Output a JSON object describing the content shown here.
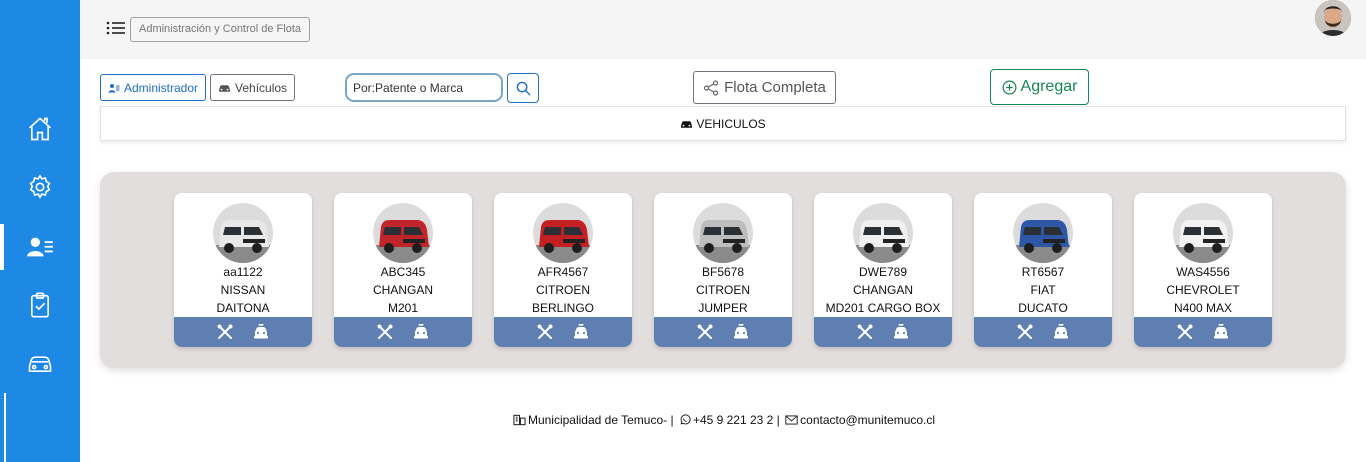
{
  "header": {
    "title": "Administración y Control de Flota"
  },
  "sidebar": {
    "items": [
      {
        "name": "home-icon"
      },
      {
        "name": "gear-icon"
      },
      {
        "name": "users-icon",
        "active": true
      },
      {
        "name": "clipboard-check-icon"
      },
      {
        "name": "car-icon"
      }
    ]
  },
  "toolbar": {
    "admin_label": "Administrador",
    "vehicles_label": "Vehículos",
    "search_placeholder": "Por:Patente o Marca",
    "fleet_label": "Flota Completa",
    "add_label": "Agregar"
  },
  "section": {
    "title": "VEHICULOS"
  },
  "vehicles": [
    {
      "plate": "aa1122",
      "brand": "NISSAN",
      "model": "DAITONA",
      "color": "#e8e8e8"
    },
    {
      "plate": "ABC345",
      "brand": "CHANGAN",
      "model": "M201",
      "color": "#c0252a"
    },
    {
      "plate": "AFR4567",
      "brand": "CITROEN",
      "model": "BERLINGO",
      "color": "#c41f22"
    },
    {
      "plate": "BF5678",
      "brand": "CITROEN",
      "model": "JUMPER",
      "color": "#bdbdbd"
    },
    {
      "plate": "DWE789",
      "brand": "CHANGAN",
      "model": "MD201 CARGO BOX",
      "color": "#f0f0f0"
    },
    {
      "plate": "RT6567",
      "brand": "FIAT",
      "model": "DUCATO",
      "color": "#2f57a8"
    },
    {
      "plate": "WAS4556",
      "brand": "CHEVROLET",
      "model": "N400 MAX",
      "color": "#f2f2f2"
    }
  ],
  "footer": {
    "org": "Municipalidad de Temuco- |",
    "phone": "+45 9 221 23 2 |",
    "email": "contacto@munitemuco.cl"
  },
  "colors": {
    "sidebar": "#1e88e5",
    "card_actions": "#5f7fb3",
    "add_green": "#198754",
    "primary_blue": "#1e6fc8"
  }
}
